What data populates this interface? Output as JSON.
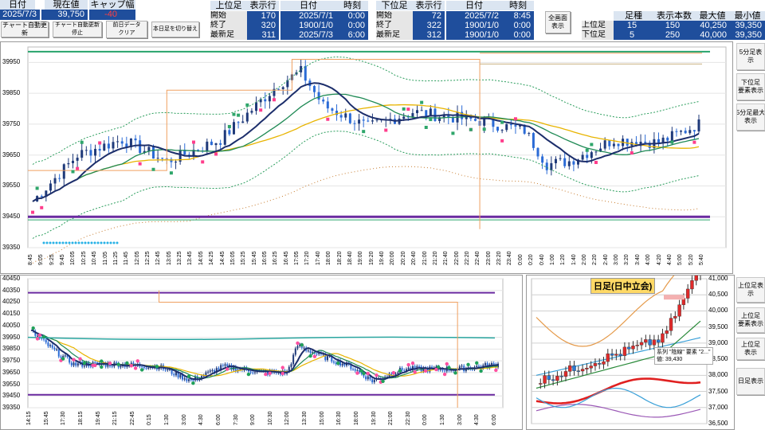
{
  "sheet": {
    "date_h": "日付",
    "price_h": "現在値",
    "gap_h": "キャップ幅",
    "date_v": "2025/7/3",
    "price_v": "39,750",
    "gap_v": "-40"
  },
  "buttons": {
    "auto_update": "チャート自動更新",
    "auto_update_stop": "チャート自動更新停止",
    "clear": "前日データ\nクリア",
    "history": "本日足を切り替え",
    "fullscreen": "全画面\n表示"
  },
  "upper": {
    "h": [
      "上位足",
      "表示行",
      "日付",
      "時刻"
    ],
    "rows": [
      {
        "label": "開始",
        "row": "170",
        "date": "2025/7/1",
        "time": "0:00"
      },
      {
        "label": "終了",
        "row": "320",
        "date": "1900/1/0",
        "time": "0:00"
      },
      {
        "label": "最新足",
        "row": "311",
        "date": "2025/7/3",
        "time": "6:00"
      }
    ]
  },
  "lower": {
    "h": [
      "下位足",
      "表示行",
      "日付",
      "時刻"
    ],
    "rows": [
      {
        "label": "開始",
        "row": "72",
        "date": "2025/7/2",
        "time": "8:45"
      },
      {
        "label": "終了",
        "row": "322",
        "date": "1900/1/0",
        "time": "0:00"
      },
      {
        "label": "最新足",
        "row": "312",
        "date": "1900/1/0",
        "time": "0:00"
      }
    ]
  },
  "summary": {
    "h": [
      "足種",
      "表示本数",
      "最大値",
      "最小値"
    ],
    "rows": [
      {
        "label": "上位足",
        "kind": "15",
        "count": "150",
        "max": "40,250",
        "min": "39,350"
      },
      {
        "label": "下位足",
        "kind": "5",
        "count": "250",
        "max": "40,000",
        "min": "39,350"
      }
    ]
  },
  "right_buttons": [
    "5分足表示",
    "下位足\n要素表示",
    "5分足最大\n表示",
    "上位足表示",
    "上位足\n要素表示",
    "上位足\n表示",
    "日足表示"
  ],
  "chart_main": {
    "y_ticks": [
      "39950",
      "39850",
      "39750",
      "39650",
      "39550",
      "39450",
      "39350"
    ],
    "x_ticks": [
      "8:45",
      "9:05",
      "9:25",
      "9:45",
      "10:05",
      "10:25",
      "10:45",
      "11:05",
      "11:25",
      "11:45",
      "12:05",
      "12:25",
      "12:45",
      "13:05",
      "13:25",
      "13:45",
      "14:05",
      "14:25",
      "14:45",
      "15:05",
      "15:25",
      "15:45",
      "16:05",
      "16:25",
      "16:45",
      "17:05",
      "17:20",
      "17:40",
      "18:00",
      "18:20",
      "18:40",
      "19:00",
      "19:20",
      "19:40",
      "20:00",
      "20:20",
      "20:40",
      "21:00",
      "21:20",
      "21:40",
      "22:00",
      "22:20",
      "22:40",
      "23:00",
      "23:20",
      "23:40",
      "0:00",
      "0:20",
      "0:40",
      "1:00",
      "1:20",
      "1:40",
      "2:00",
      "2:20",
      "2:40",
      "3:00",
      "3:20",
      "3:40",
      "4:00",
      "4:20",
      "4:40",
      "5:00",
      "5:20",
      "5:40"
    ]
  },
  "chart_sub": {
    "y_ticks": [
      "40450",
      "40350",
      "40250",
      "40150",
      "40050",
      "39950",
      "39850",
      "39750",
      "39650",
      "39550",
      "39450",
      "39350"
    ],
    "x_ticks": [
      "14:15",
      "15:45",
      "17:30",
      "18:15",
      "19:45",
      "21:15",
      "22:45",
      "0:15",
      "1:30",
      "3:00",
      "4:30",
      "6:00",
      "7:30",
      "9:00",
      "10:30",
      "12:00",
      "13:30",
      "15:00",
      "16:30",
      "18:00",
      "19:30",
      "21:00",
      "22:30",
      "0:00",
      "1:30",
      "3:00",
      "4:30",
      "6:00"
    ]
  },
  "chart_day": {
    "title": "日足(日中立会)",
    "y_ticks": [
      "41,000",
      "40,500",
      "40,000",
      "39,500",
      "39,000",
      "38,500",
      "38,000",
      "37,500",
      "37,000",
      "36,500"
    ],
    "tooltip": "系列 \"陰線\" 要素 \"2...\"\n値: 39,430"
  },
  "colors": {
    "header_bg": "#dbe5f1",
    "value_bg": "#1f4e9c",
    "neg": "#ff4040"
  }
}
